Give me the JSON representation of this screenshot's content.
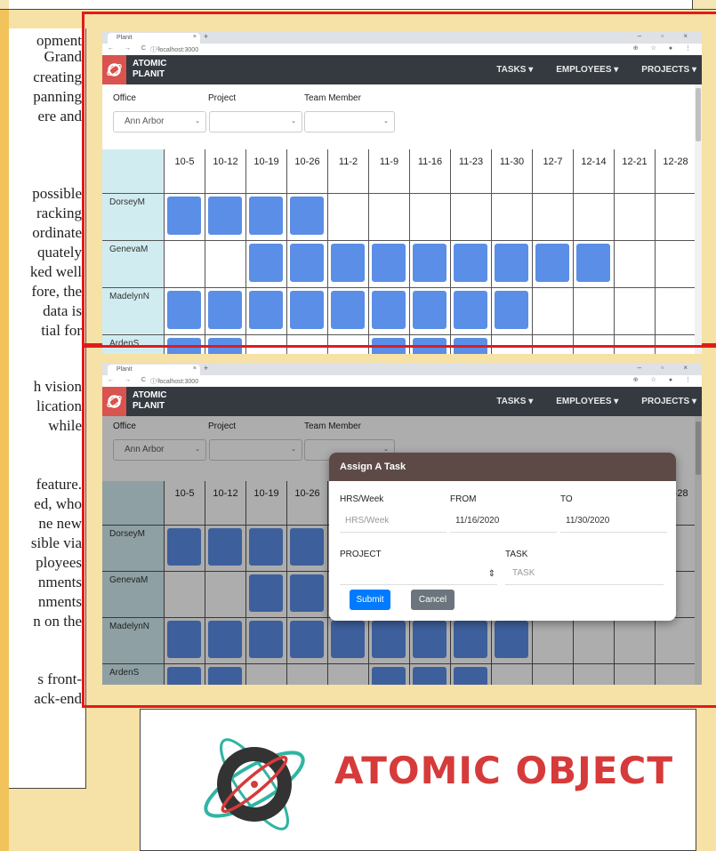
{
  "article": {
    "fragments": [
      "opment",
      "Grand",
      "creating",
      "panning",
      "ere and",
      "possible",
      "racking",
      "ordinate",
      "quately",
      "ked well",
      "fore, the",
      "data is",
      "tial for",
      "h vision",
      "lication",
      "while",
      "feature.",
      "ed, who",
      "ne new",
      "sible via",
      "ployees",
      "nments",
      "nments",
      "n on the",
      "s front-",
      "ack-end"
    ]
  },
  "browser_tab": {
    "title": "Planit",
    "close": "×",
    "new_tab": "+"
  },
  "window_controls": "– ▫ ×",
  "address_bar": {
    "nav": "← → C ⌂",
    "url": "ⓘ localhost:3000",
    "tools": "⊕ ☆ ● ⋮"
  },
  "app": {
    "logo_line1": "ATOMIC",
    "logo_line2": "PLANIT",
    "nav": {
      "tasks": "TASKS ▾",
      "employees": "EMPLOYEES ▾",
      "projects": "PROJECTS ▾"
    }
  },
  "filters": {
    "office_label": "Office",
    "office_value": "Ann Arbor",
    "project_label": "Project",
    "project_value": "",
    "member_label": "Team Member",
    "member_value": "",
    "caret": "⌄"
  },
  "schedule": {
    "weeks": [
      "10-5",
      "10-12",
      "10-19",
      "10-26",
      "11-2",
      "11-9",
      "11-16",
      "11-23",
      "11-30",
      "12-7",
      "12-14",
      "12-21",
      "12-28"
    ],
    "employees": [
      {
        "name": "DorseyM",
        "assigned_weeks": [
          0,
          1,
          2,
          3
        ]
      },
      {
        "name": "GenevaM",
        "assigned_weeks": [
          2,
          3,
          4,
          5,
          6,
          7,
          8,
          9,
          10
        ]
      },
      {
        "name": "MadelynN",
        "assigned_weeks": [
          0,
          1,
          2,
          3,
          4,
          5,
          6,
          7,
          8
        ]
      },
      {
        "name": "ArdenS",
        "assigned_weeks": [
          0,
          1,
          5,
          6,
          7
        ]
      }
    ]
  },
  "modal": {
    "title": "Assign A Task",
    "hrs_label": "HRS/Week",
    "hrs_placeholder": "HRS/Week",
    "from_label": "FROM",
    "from_value": "11/16/2020",
    "to_label": "TO",
    "to_value": "11/30/2020",
    "project_label": "PROJECT",
    "project_spinner": "⇕",
    "task_label": "TASK",
    "task_placeholder": "TASK",
    "submit": "Submit",
    "cancel": "Cancel"
  },
  "brand": {
    "name": "ATOMIC OBJECT",
    "ring_color": "#2fb5a3",
    "core_color": "#333333",
    "accent": "#d63a3a"
  },
  "colors": {
    "frame": "#e01b1b",
    "navbar": "#343a40",
    "block": "#5b8ee6",
    "name_col": "#d1ecf1"
  }
}
